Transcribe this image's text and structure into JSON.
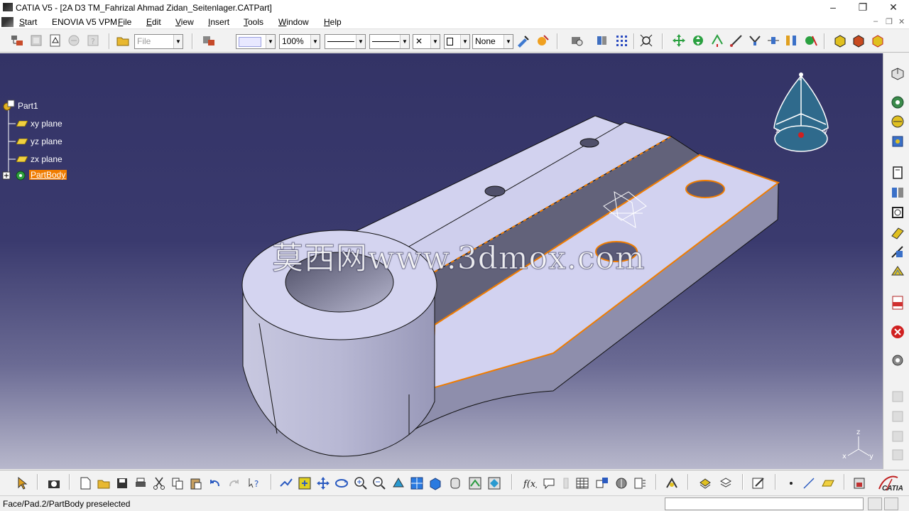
{
  "window": {
    "title": "CATIA V5 - [2A D3 TM_Fahrizal Ahmad Zidan_Seitenlager.CATPart]",
    "minimize_glyph": "–",
    "restore_glyph": "❐",
    "close_glyph": "✕"
  },
  "menubar": {
    "items": [
      {
        "label": "Start",
        "mnemonic": "S",
        "rest": "tart"
      },
      {
        "label": "ENOVIA V5 VPM",
        "mnemonic": "",
        "rest": "ENOVIA V5 VPM"
      },
      {
        "label": "File",
        "mnemonic": "F",
        "rest": "ile"
      },
      {
        "label": "Edit",
        "mnemonic": "E",
        "rest": "dit"
      },
      {
        "label": "View",
        "mnemonic": "V",
        "rest": "iew"
      },
      {
        "label": "Insert",
        "mnemonic": "I",
        "rest": "nsert"
      },
      {
        "label": "Tools",
        "mnemonic": "T",
        "rest": "ools"
      },
      {
        "label": "Window",
        "mnemonic": "W",
        "rest": "indow"
      },
      {
        "label": "Help",
        "mnemonic": "H",
        "rest": "elp"
      }
    ],
    "doc_minimize": "–",
    "doc_restore": "❐",
    "doc_close": "✕"
  },
  "toolbar": {
    "file_combo": "File",
    "zoom_combo": "100%",
    "x_combo": "✕",
    "layer_combo": "None"
  },
  "tree": {
    "root": "Part1",
    "items": [
      "xy plane",
      "yz plane",
      "zx plane"
    ],
    "body": "PartBody"
  },
  "compass": {
    "x_label": "x",
    "y_label": "y",
    "z_label": "z"
  },
  "axis_triad": {
    "x_label": "x",
    "y_label": "y",
    "z_label": "z"
  },
  "watermark": "莫西网www.3dmox.com",
  "status": {
    "text": "Face/Pad.2/PartBody preselected",
    "input_value": ""
  },
  "brand": {
    "logo_text": "CATIA"
  },
  "colors": {
    "selection_orange": "#f07c00",
    "part_face": "#d0d0f0",
    "background_top": "#333366",
    "background_bottom": "#b8b8cc"
  },
  "icons": {
    "title_app": "catia-app-icon",
    "start": "start-menu-icon",
    "compass": "3d-compass-icon",
    "triad": "axis-triad-icon"
  }
}
